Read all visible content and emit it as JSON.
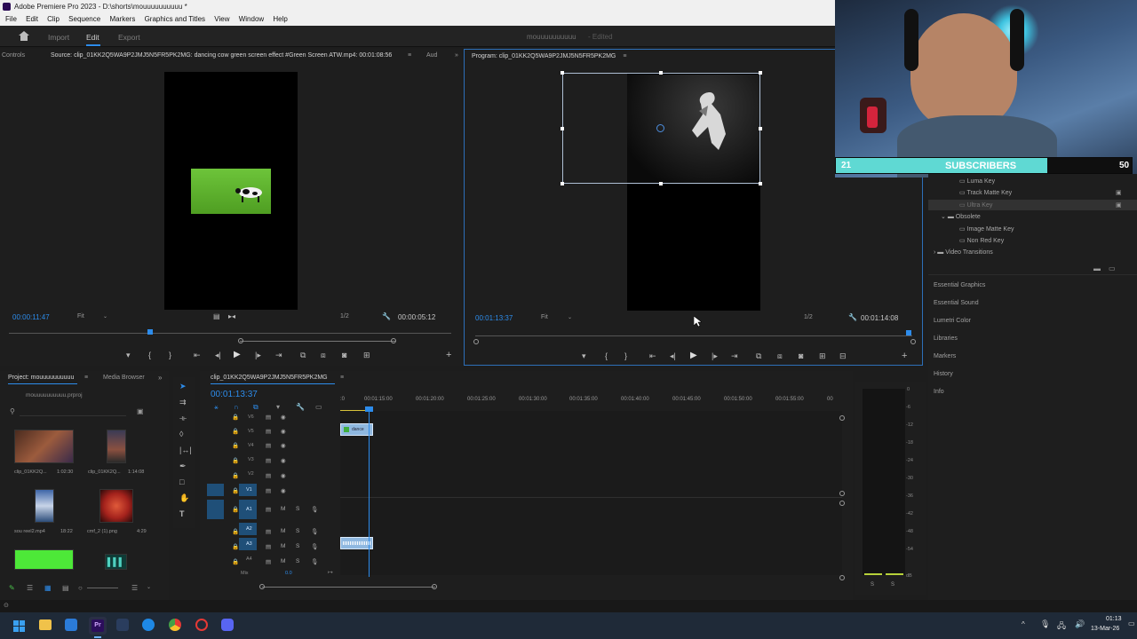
{
  "window": {
    "title": "Adobe Premiere Pro 2023 - D:\\shorts\\mouuuuuuuuuu *",
    "menu": [
      "File",
      "Edit",
      "Clip",
      "Sequence",
      "Markers",
      "Graphics and Titles",
      "View",
      "Window",
      "Help"
    ]
  },
  "header": {
    "workspaces": [
      "Import",
      "Edit",
      "Export"
    ],
    "active_workspace": "Edit",
    "project_name": "mouuuuuuuuuu",
    "project_state": "- Edited"
  },
  "source_monitor": {
    "tabs": [
      "Controls",
      "Source: clip_01KK2Q5WA9P2JMJ5N5FR5PK2MG: dancing cow green screen effect  #Green Screen ATW.mp4: 00:01:08:56",
      "Aud"
    ],
    "timecode": "00:00:11:47",
    "fit": "Fit",
    "resolution": "1/2",
    "duration": "00:00:05:12"
  },
  "program_monitor": {
    "tab": "Program: clip_01KK2Q5WA9P2JMJ5N5FR5PK2MG",
    "timecode": "00:01:13:37",
    "fit": "Fit",
    "resolution": "1/2",
    "duration": "00:01:14:08"
  },
  "webcam": {
    "left_count": "21",
    "label": "SUBSCRIBERS",
    "right_count": "50"
  },
  "effects": {
    "items": [
      "Luma Key",
      "Track Matte Key",
      "Ultra Key"
    ],
    "folder_obsolete": "Obsolete",
    "obsolete_items": [
      "Image Matte Key",
      "Non Red Key"
    ],
    "video_transitions": "Video Transitions"
  },
  "side_panels": [
    "Essential Graphics",
    "Essential Sound",
    "Lumetri Color",
    "Libraries",
    "Markers",
    "History",
    "Info"
  ],
  "project_panel": {
    "tabs": [
      "Project: mouuuuuuuuuu",
      "Media Browser"
    ],
    "file": "mouuuuuuuuuu.prproj",
    "items": [
      {
        "name": "clip_01KK2Q...",
        "duration": "1:02:30"
      },
      {
        "name": "clip_01KK2Q...",
        "duration": "1:14:08"
      },
      {
        "name": "sou reel2.mp4",
        "duration": "18:22"
      },
      {
        "name": "cmf_2 (1).png",
        "duration": "4:29"
      }
    ]
  },
  "timeline": {
    "tab": "clip_01KK2Q5WA9P2JMJ5N5FR5PK2MG",
    "timecode": "00:01:13:37",
    "ruler": [
      "00:01:15:00",
      "00:01:20:00",
      "00:01:25:00",
      "00:01:30:00",
      "00:01:35:00",
      "00:01:40:00",
      "00:01:45:00",
      "00:01:50:00",
      "00:01:55:00",
      "00"
    ],
    "video_tracks": [
      "V6",
      "V5",
      "V4",
      "V3",
      "V2",
      "V1"
    ],
    "audio_tracks": [
      "A1",
      "A2",
      "A3",
      "A4"
    ],
    "mix_label": "Mix",
    "mix_value": "0.0",
    "clip_v5_label": "dance"
  },
  "meter": {
    "scale": [
      "0",
      "-6",
      "-12",
      "-18",
      "-24",
      "-30",
      "-36",
      "-42",
      "-48",
      "-54",
      "dB"
    ],
    "solo": [
      "S",
      "S"
    ]
  },
  "taskbar": {
    "time": "01:13",
    "date": "13-Mar-26"
  }
}
